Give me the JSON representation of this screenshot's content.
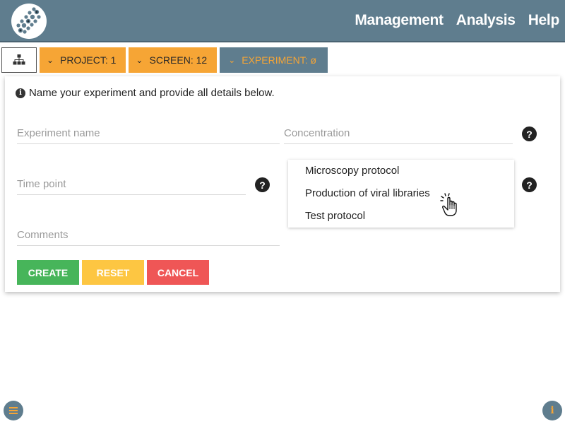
{
  "header": {
    "logo_icon": "dna-helix-logo-icon",
    "nav": [
      "Management",
      "Analysis",
      "Help"
    ]
  },
  "breadcrumb": {
    "home_icon": "hierarchy-icon",
    "items": [
      {
        "label": "PROJECT: 1",
        "style": "orange"
      },
      {
        "label": "SCREEN: 12",
        "style": "orange"
      },
      {
        "label": "EXPERIMENT: ø",
        "style": "dark"
      }
    ]
  },
  "form": {
    "info_text": "Name your experiment and provide all details below.",
    "experiment_name": {
      "placeholder": "Experiment name",
      "value": ""
    },
    "concentration": {
      "placeholder": "Concentration",
      "value": ""
    },
    "time_point": {
      "placeholder": "Time point",
      "value": ""
    },
    "comments": {
      "placeholder": "Comments",
      "value": ""
    },
    "protocol_options": [
      "Microscopy protocol",
      "Production of viral libraries",
      "Test protocol"
    ],
    "help_icon": "?",
    "buttons": {
      "create": "CREATE",
      "reset": "RESET",
      "cancel": "CANCEL"
    }
  },
  "colors": {
    "header": "#5f7d8e",
    "orange": "#f6a535",
    "create": "#47b55a",
    "reset": "#fdc642",
    "cancel": "#ef5656"
  },
  "footer": {
    "menu_icon": "menu-icon",
    "info_icon": "info-icon"
  }
}
